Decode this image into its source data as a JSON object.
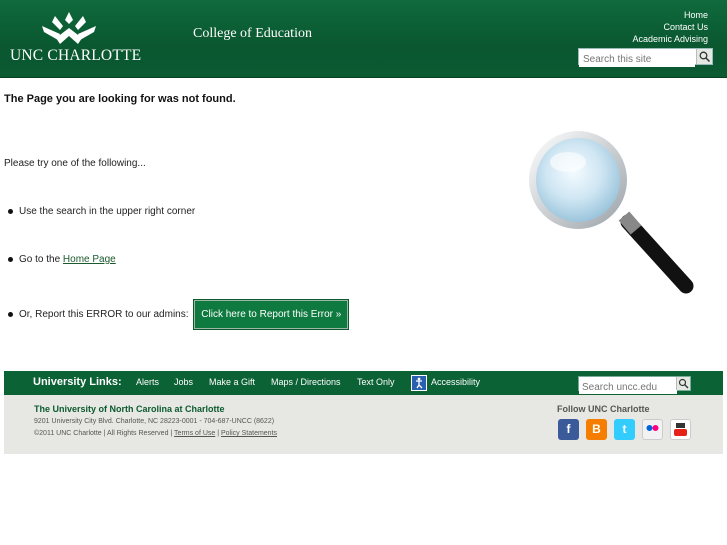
{
  "header": {
    "logo_text": "UNC CHARLOTTE",
    "college": "College of Education",
    "links": [
      "Home",
      "Contact Us",
      "Academic Advising"
    ],
    "search_placeholder": "Search this site"
  },
  "main": {
    "heading": "The Page you are looking for was not found.",
    "intro": "Please try one of the following...",
    "option1": "Use the search in the upper right corner",
    "option2_prefix": "Go to the ",
    "option2_link": "Home Page",
    "option3_prefix": "Or, Report this ERROR to our admins:",
    "report_button": "Click here to Report this Error »"
  },
  "footer": {
    "links_title": "University Links:",
    "links": [
      "Alerts",
      "Jobs",
      "Make a Gift",
      "Maps / Directions",
      "Text Only",
      "Accessibility"
    ],
    "search_placeholder": "Search uncc.edu",
    "university": "The University of North Carolina at Charlotte",
    "address": "9201 University City Blvd. Charlotte, NC 28223-0001 - 704-687-UNCC (8622)",
    "copyright": "©2011 UNC Charlotte | All Rights Reserved | ",
    "terms": "Terms of Use",
    "sep": " | ",
    "policy": "Policy Statements",
    "follow": "Follow UNC Charlotte",
    "social": [
      "facebook-icon",
      "blogger-icon",
      "twitter-icon",
      "flickr-icon",
      "youtube-icon"
    ]
  },
  "colors": {
    "brand_green": "#0b6234",
    "footer_bg": "#e7e8e3",
    "button_green": "#0f7a3f"
  }
}
